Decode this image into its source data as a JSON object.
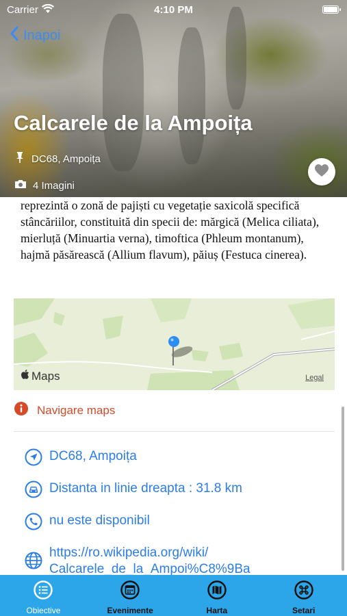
{
  "status_bar": {
    "carrier": "Carrier",
    "time": "4:10 PM"
  },
  "header": {
    "back_label": "Inapoi",
    "title": "Calcarele de la Ampoița",
    "location": "DC68, Ampoița",
    "images": "4 Imagini"
  },
  "description": "reprezintă o zonă de pajiști cu vegetație saxicolă specifică stâncăriilor, constituită din specii de: mărgică (Melica ciliata), mierluță (Minuartia verna), timoftica (Phleum montanum), hajmă păsărească (Allium flavum), păiuș (Festuca cinerea).",
  "map": {
    "logo": "Maps",
    "legal": "Legal"
  },
  "navigation": {
    "label": "Navigare maps"
  },
  "info": {
    "address": "DC68, Ampoița",
    "distance": "Distanta in linie dreapta : 31.8 km",
    "phone": "nu este disponibil",
    "website_line1": "https://ro.wikipedia.org/wiki/",
    "website_line2": "Calcarele_de_la_Ampoi%C8%9Ba"
  },
  "tabs": [
    {
      "label": "Obiective",
      "icon": "list-icon",
      "active": true
    },
    {
      "label": "Evenimente",
      "icon": "calendar-icon",
      "active": false
    },
    {
      "label": "Harta",
      "icon": "map-icon",
      "active": false
    },
    {
      "label": "Setari",
      "icon": "command-icon",
      "active": false
    }
  ],
  "colors": {
    "accent_blue": "#2b7de9",
    "nav_red": "#d64a2a",
    "tabbar": "#2ca6e8",
    "map_pin": "#2b8ef0"
  }
}
